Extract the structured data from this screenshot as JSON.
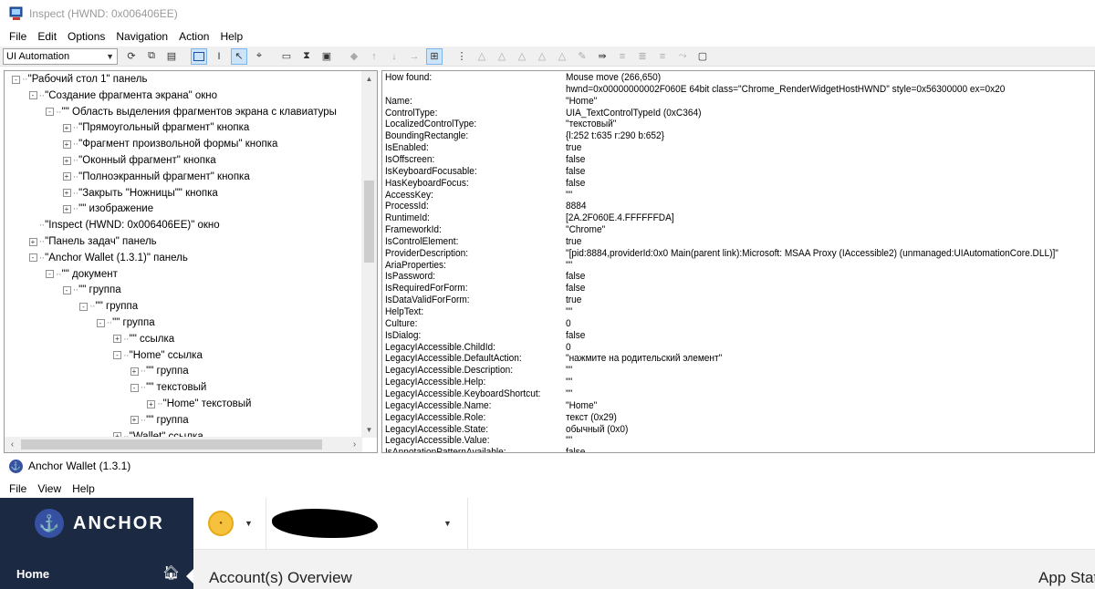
{
  "inspect": {
    "title": "Inspect  (HWND: 0x006406EE)",
    "menu": [
      "File",
      "Edit",
      "Options",
      "Navigation",
      "Action",
      "Help"
    ],
    "mode_select": "UI Automation",
    "tree": [
      {
        "label": "\"Рабочий стол 1\" панель",
        "exp": "-"
      },
      {
        "label": "\"Создание фрагмента экрана\" окно",
        "exp": "-"
      },
      {
        "label": "\"\" Область выделения фрагментов экрана с клавиатуры",
        "exp": "-"
      },
      {
        "label": "\"Прямоугольный фрагмент\" кнопка",
        "exp": "+"
      },
      {
        "label": "\"Фрагмент произвольной формы\" кнопка",
        "exp": "+"
      },
      {
        "label": "\"Оконный фрагмент\" кнопка",
        "exp": "+"
      },
      {
        "label": "\"Полноэкранный фрагмент\" кнопка",
        "exp": "+"
      },
      {
        "label": "\"Закрыть \"Ножницы\"\" кнопка",
        "exp": "+"
      },
      {
        "label": "\"\" изображение",
        "exp": "+"
      },
      {
        "label": "\"Inspect  (HWND: 0x006406EE)\" окно",
        "exp": ""
      },
      {
        "label": "\"Панель задач\" панель",
        "exp": "+"
      },
      {
        "label": "\"Anchor Wallet (1.3.1)\" панель",
        "exp": "-"
      },
      {
        "label": "\"\" документ",
        "exp": "-"
      },
      {
        "label": "\"\" группа",
        "exp": "-"
      },
      {
        "label": "\"\" группа",
        "exp": "-"
      },
      {
        "label": "\"\" группа",
        "exp": "-"
      },
      {
        "label": "\"\" ссылка",
        "exp": "+"
      },
      {
        "label": "\"Home\" ссылка",
        "exp": "-"
      },
      {
        "label": "\"\" группа",
        "exp": "+"
      },
      {
        "label": "\"\" текстовый",
        "exp": "-"
      },
      {
        "label": "\"Home\" текстовый",
        "exp": "+"
      },
      {
        "label": "\"\" группа",
        "exp": "+"
      },
      {
        "label": "\"Wallet\" ссылка",
        "exp": "+"
      }
    ],
    "properties": [
      {
        "k": "How found:",
        "v": "Mouse move (266,650)"
      },
      {
        "k": "",
        "v": "hwnd=0x00000000002F060E 64bit class=\"Chrome_RenderWidgetHostHWND\" style=0x56300000 ex=0x20"
      },
      {
        "k": "Name:",
        "v": "\"Home\""
      },
      {
        "k": "ControlType:",
        "v": "UIA_TextControlTypeId (0xC364)"
      },
      {
        "k": "LocalizedControlType:",
        "v": "\"текстовый\""
      },
      {
        "k": "BoundingRectangle:",
        "v": "{l:252 t:635 r:290 b:652}"
      },
      {
        "k": "IsEnabled:",
        "v": "true"
      },
      {
        "k": "IsOffscreen:",
        "v": "false"
      },
      {
        "k": "IsKeyboardFocusable:",
        "v": "false"
      },
      {
        "k": "HasKeyboardFocus:",
        "v": "false"
      },
      {
        "k": "AccessKey:",
        "v": "\"\""
      },
      {
        "k": "ProcessId:",
        "v": "8884"
      },
      {
        "k": "RuntimeId:",
        "v": "[2A.2F060E.4.FFFFFFDA]"
      },
      {
        "k": "FrameworkId:",
        "v": "\"Chrome\""
      },
      {
        "k": "IsControlElement:",
        "v": "true"
      },
      {
        "k": "ProviderDescription:",
        "v": "\"[pid:8884,providerId:0x0 Main(parent link):Microsoft: MSAA Proxy (IAccessible2) (unmanaged:UIAutomationCore.DLL)]\""
      },
      {
        "k": "AriaProperties:",
        "v": "\"\""
      },
      {
        "k": "IsPassword:",
        "v": "false"
      },
      {
        "k": "IsRequiredForForm:",
        "v": "false"
      },
      {
        "k": "IsDataValidForForm:",
        "v": "true"
      },
      {
        "k": "HelpText:",
        "v": "\"\""
      },
      {
        "k": "Culture:",
        "v": "0"
      },
      {
        "k": "IsDialog:",
        "v": "false"
      },
      {
        "k": "LegacyIAccessible.ChildId:",
        "v": "0"
      },
      {
        "k": "LegacyIAccessible.DefaultAction:",
        "v": "\"нажмите на родительский элемент\""
      },
      {
        "k": "LegacyIAccessible.Description:",
        "v": "\"\""
      },
      {
        "k": "LegacyIAccessible.Help:",
        "v": "\"\""
      },
      {
        "k": "LegacyIAccessible.KeyboardShortcut:",
        "v": "\"\""
      },
      {
        "k": "LegacyIAccessible.Name:",
        "v": "\"Home\""
      },
      {
        "k": "LegacyIAccessible.Role:",
        "v": "текст (0x29)"
      },
      {
        "k": "LegacyIAccessible.State:",
        "v": "обычный (0x0)"
      },
      {
        "k": "LegacyIAccessible.Value:",
        "v": "\"\""
      },
      {
        "k": "IsAnnotationPatternAvailable:",
        "v": "false"
      }
    ]
  },
  "anchor": {
    "title": "Anchor Wallet (1.3.1)",
    "menu": [
      "File",
      "View",
      "Help"
    ],
    "logo_text": "ANCHOR",
    "nav_home": "Home",
    "page_title": "Account(s) Overview",
    "app_status": "App Status",
    "brand_color": "#3650a2",
    "sidebar_color": "#1b2a42"
  }
}
